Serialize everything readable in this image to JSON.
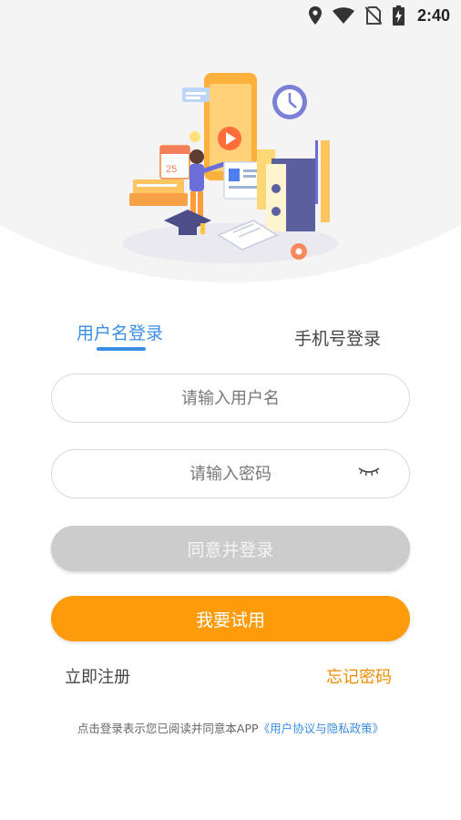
{
  "status_bar": {
    "time": "2:40",
    "icons": [
      "location-icon",
      "wifi-icon",
      "no-sim-icon",
      "battery-icon"
    ]
  },
  "illustration": {
    "icon": "study-illustration"
  },
  "tabs": {
    "username_login": "用户名登录",
    "phone_login": "手机号登录",
    "active": "username_login"
  },
  "form": {
    "username_placeholder": "请输入用户名",
    "username_value": "",
    "password_placeholder": "请输入密码",
    "password_value": "",
    "password_toggle_icon": "eye-closed-icon"
  },
  "buttons": {
    "login": "同意并登录",
    "trial": "我要试用"
  },
  "links": {
    "register": "立即注册",
    "forgot_password": "忘记密码"
  },
  "agreement": {
    "prefix": "点击登录表示您已阅读并同意本APP",
    "policy": "《用户协议与隐私政策》"
  },
  "colors": {
    "accent_blue": "#3a8ee6",
    "orange": "#fd9b0a",
    "forgot_orange": "#f08c00",
    "disabled_gray": "#cccccc"
  }
}
